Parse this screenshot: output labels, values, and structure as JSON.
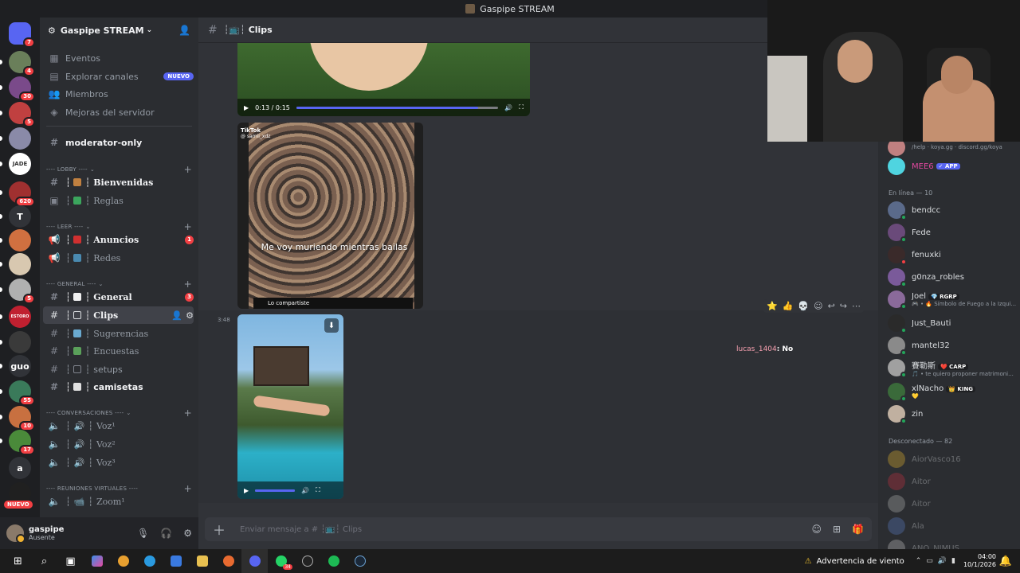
{
  "window": {
    "title": "Gaspipe STREAM"
  },
  "servers": [
    {
      "label": "",
      "badge": "7",
      "color": "#5865f2"
    },
    {
      "label": "",
      "badge": "4",
      "color": "#6a7f5a"
    },
    {
      "label": "",
      "badge": "30",
      "color": "#7a4a8a"
    },
    {
      "label": "",
      "badge": "5",
      "color": "#c04040"
    },
    {
      "label": "",
      "badge": "",
      "color": "#8a8aa8"
    },
    {
      "label": "JADE",
      "badge": "",
      "color": "#ffffff"
    },
    {
      "label": "",
      "badge": "620",
      "color": "#a03030"
    },
    {
      "label": "T",
      "badge": "",
      "color": "#313338"
    },
    {
      "label": "",
      "badge": "",
      "color": "#d07040"
    },
    {
      "label": "",
      "badge": "",
      "color": "#d8c8b0"
    },
    {
      "label": "",
      "badge": "5",
      "color": "#b0b0b0"
    },
    {
      "label": "ESTORO",
      "badge": "",
      "color": "#c02030"
    },
    {
      "label": "",
      "badge": "",
      "color": "#3a3a3a"
    },
    {
      "label": "guo",
      "badge": "",
      "color": "#313338"
    },
    {
      "label": "",
      "badge": "55",
      "color": "#3a7a5a"
    },
    {
      "label": "",
      "badge": "10",
      "color": "#c87040"
    },
    {
      "label": "",
      "badge": "17",
      "color": "#4a8a3a"
    },
    {
      "label": "a",
      "badge": "",
      "color": "#313338"
    },
    {
      "label": "",
      "badge": "",
      "color": "#202020"
    }
  ],
  "servers_nuevo": "NUEVO",
  "guild": {
    "name": "Gaspipe STREAM"
  },
  "nav": {
    "events": "Eventos",
    "explore": "Explorar canales",
    "explore_badge": "NUEVO",
    "members": "Miembros",
    "boost": "Mejoras del servidor"
  },
  "channels": {
    "moderator": "moderator-only",
    "cat_lobby": "---- LOBBY ----",
    "bienvenidas": "Bienvenidas",
    "reglas": "Reglas",
    "cat_leer": "---- LEER ----",
    "anuncios": "Anuncios",
    "anuncios_count": "1",
    "redes": "Redes",
    "cat_general": "---- GENERAL ----",
    "general": "General",
    "general_count": "3",
    "clips": "Clips",
    "sugerencias": "Sugerencias",
    "encuestas": "Encuestas",
    "setups": "setups",
    "camisetas": "camisetas",
    "cat_conv": "---- CONVERSACIONES ----",
    "voz1": "Voz¹",
    "voz2": "Voz²",
    "voz3": "Voz³",
    "cat_reuniones": "---- REUNIONES VIRTUALES ----",
    "zoom": "Zoom¹"
  },
  "user": {
    "name": "gaspipe",
    "status": "Ausente"
  },
  "chat": {
    "channel": "Clips",
    "video1_time": "0:13 / 0:15",
    "video1_progress": 0.9,
    "tiktok_label": "TikTok",
    "tiktok_user": "@ samii_xdz",
    "tiktok_caption": "Me voy muriendo mientras bailas",
    "tiktok_shared": "Lo compartiste",
    "timestamp": "3:48",
    "lucas_name": "lucas_1404",
    "lucas_text": ": No",
    "composer_placeholder": "Enviar mensaje a # ┆📺┆ Clips"
  },
  "members": {
    "top_sub": "/help · koya.gg · discord.gg/koya",
    "mee6": "MEE6",
    "mee6_tag": "✓ APP",
    "online_header": "En línea — 10",
    "online": [
      {
        "name": "bendcc",
        "sub": "",
        "tag": "",
        "color": "#5a6a8a",
        "status": "#23a55a"
      },
      {
        "name": "Fede",
        "sub": "",
        "tag": "",
        "color": "#6a4a7a",
        "status": "#23a55a"
      },
      {
        "name": "fenuxki",
        "sub": "",
        "tag": "",
        "color": "#3a2a2a",
        "status": "#f23f43"
      },
      {
        "name": "g0nza_robles",
        "sub": "",
        "tag": "",
        "color": "#7a5a9a",
        "status": "#23a55a"
      },
      {
        "name": "Joel",
        "sub": "🎮 • 🔥 Símbolo de Fuego a la Izqui...",
        "tag": "💎 RGRP",
        "color": "#8a6a9a",
        "status": "#23a55a"
      },
      {
        "name": "Just_Bauti",
        "sub": "",
        "tag": "",
        "color": "#2a2a2a",
        "status": "#23a55a"
      },
      {
        "name": "mantel32",
        "sub": "",
        "tag": "",
        "color": "#8a8a8a",
        "status": "#23a55a"
      },
      {
        "name": "賽勒斯",
        "sub": "🎵 • te quiero proponer matrimoni...",
        "tag": "❤️ CARP",
        "color": "#a0a0a0",
        "status": "#23a55a"
      },
      {
        "name": "xlNacho",
        "sub": "💛",
        "tag": "👑 KING",
        "color": "#3a6a3a",
        "status": "#23a55a"
      },
      {
        "name": "zin",
        "sub": "",
        "tag": "",
        "color": "#c0b0a0",
        "status": "#23a55a"
      }
    ],
    "offline_header": "Desconectado — 82",
    "offline": [
      {
        "name": "AiorVasco16",
        "color": "#e0b030"
      },
      {
        "name": "Aitor",
        "color": "#c03040"
      },
      {
        "name": "Aitor",
        "color": "#b0b0b0"
      },
      {
        "name": "Ala",
        "color": "#5a7ac0"
      },
      {
        "name": "ANO_NIMUS",
        "color": "#c0c0c0"
      }
    ]
  },
  "taskbar": {
    "weather": "Advertencia de viento",
    "time": "04:00",
    "date": "10/1/2026",
    "whatsapp_count": "34"
  }
}
